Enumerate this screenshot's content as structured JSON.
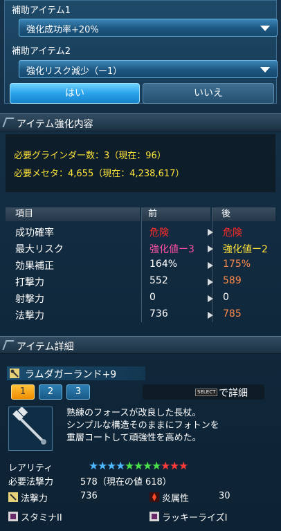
{
  "support_items": {
    "item1_title": "補助アイテム1",
    "item1_value": "強化成功率+20%",
    "item2_title": "補助アイテム2",
    "item2_value": "強化リスク減少（ー1）",
    "yes_label": "はい",
    "no_label": "いいえ"
  },
  "enhance": {
    "section_title": "アイテム強化内容",
    "grinder_line": "必要グラインダー数：3（現在：96）",
    "meseta_line": "必要メセタ：4,655（現在：4,238,617）",
    "headers": {
      "item": "項目",
      "before": "前",
      "after": "後"
    },
    "rows": [
      {
        "name": "成功確率",
        "before": "危険",
        "after": "危険",
        "before_color": "#ff2a2a",
        "after_color": "#ff2a2a"
      },
      {
        "name": "最大リスク",
        "before": "強化値ー3",
        "after": "強化値ー2",
        "before_color": "#ff4fa3",
        "after_color": "#ffe43a"
      },
      {
        "name": "効果補正",
        "before": "164%",
        "after": "175%",
        "before_color": "#ffffff",
        "after_color": "#ff8a4a"
      },
      {
        "name": "打撃力",
        "before": "552",
        "after": "589",
        "before_color": "#ffffff",
        "after_color": "#ff8a4a"
      },
      {
        "name": "射撃力",
        "before": "0",
        "after": "0",
        "before_color": "#ffffff",
        "after_color": "#ffffff"
      },
      {
        "name": "法撃力",
        "before": "736",
        "after": "785",
        "before_color": "#ffffff",
        "after_color": "#ff8a4a"
      }
    ]
  },
  "item_detail": {
    "section_title": "アイテム詳細",
    "item_name": "ラムダガーランド+9",
    "tabs": [
      "1",
      "2",
      "3"
    ],
    "select_key": "SELECT",
    "detail_label": "で詳細",
    "description": [
      "熟練のフォースが改良した長杖。",
      "シンプルな構造そのままにフォトンを",
      "重層コートして頑強性を高めた。"
    ],
    "rarity_label": "レアリティ",
    "rarity_stars": 11,
    "star_colors": [
      "#4fb8ff",
      "#4fb8ff",
      "#4fb8ff",
      "#4fb8ff",
      "#4be04b",
      "#4be04b",
      "#4be04b",
      "#4be04b",
      "#ff3a3a",
      "#ff3a3a",
      "#ff3a3a"
    ],
    "req_label": "必要法撃力",
    "req_value": "578（現在の値 618）",
    "stat1_label": "法撃力",
    "stat1_value": "736",
    "stat2_label": "炎属性",
    "stat2_value": "30",
    "ability1": "スタミナII",
    "ability2": "ラッキーライズI"
  }
}
